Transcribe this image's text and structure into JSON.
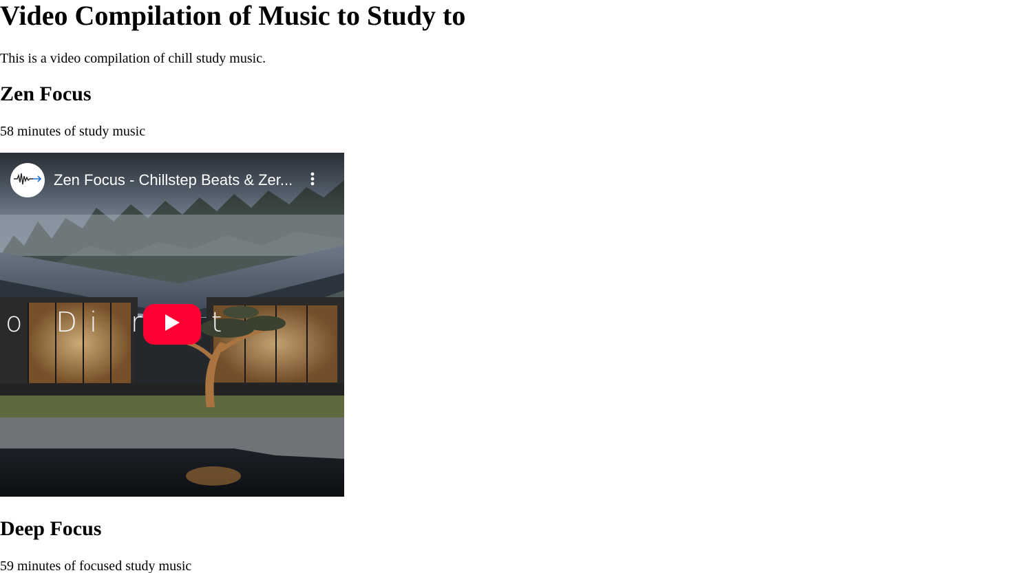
{
  "page": {
    "title": "Video Compilation of Music to Study to",
    "intro": "This is a video compilation of chill study music."
  },
  "sections": [
    {
      "heading": "Zen Focus",
      "description": "58 minutes of study music",
      "video": {
        "title": "Zen Focus - Chillstep Beats & Zer...",
        "overlay_text": "o Di   ract",
        "channel_icon": "waveform-logo-icon",
        "menu_icon": "more-vertical-icon",
        "play_icon": "play-icon",
        "play_color": "#ff0033"
      }
    },
    {
      "heading": "Deep Focus",
      "description": "59 minutes of focused study music"
    }
  ]
}
